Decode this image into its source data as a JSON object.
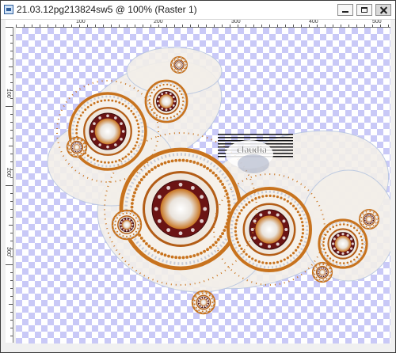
{
  "window": {
    "title": "21.03.12pg213824sw5 @ 100% (Raster 1)",
    "icons": {
      "app": "psp-document-icon",
      "minimize": "minimize-icon",
      "maximize": "maximize-icon",
      "close": "close-icon"
    }
  },
  "rulers": {
    "horizontal_labels": [
      "100",
      "200",
      "300",
      "400",
      "500"
    ],
    "vertical_labels": [
      "100",
      "200",
      "300"
    ]
  },
  "image": {
    "watermark_text": "claudia",
    "colors": {
      "checker": "#c9c9f7",
      "copper": "#c8731e",
      "dark_red": "#6b1414",
      "silver": "#c9ccd6",
      "pale_blue": "#b9c7e0"
    }
  }
}
